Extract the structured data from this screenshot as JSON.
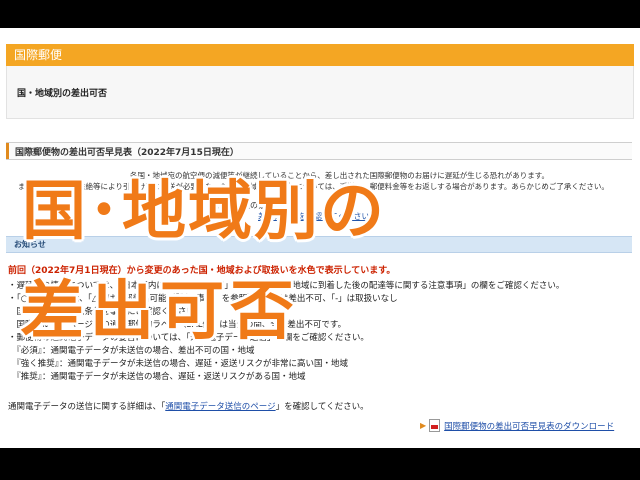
{
  "colors": {
    "header_orange": "#f4a623",
    "overlay_orange": "#f07a18",
    "notice_red": "#cc2200",
    "link_blue": "#1f4fa8",
    "info_bar_blue": "#d6e6f5"
  },
  "header": {
    "title": "国際郵便"
  },
  "breadcrumb": {
    "current": "国・地域別の差出可否"
  },
  "section": {
    "title": "国際郵便物の差出可否早見表（2022年7月15日現在）"
  },
  "notices": {
    "line1": "各国・地域宛の航空便の減便等が継続していることから、差し出された国際郵便物のお届けに遅延が生じる恐れがあります。",
    "line2": "また、輸送経路の途絶等により引受け後に返送が必要となった国・地域宛の郵便物については、返送し、郵便料金等をお返しする場合があります。あらかじめご了承ください。",
    "line3": "差出・配達の条件は",
    "link": "差出条件表を確認してください"
  },
  "info_bar": {
    "label": "お知らせ"
  },
  "change_notice": "前回（2022年7月1日現在）から変更のあった国・地域および取扱いを水色で表示しています。",
  "bullets": [
    "・遅延等の情報については、「日本国内における遅延情報」および「各国・地域に到着した後の配達等に関する注意事項」の欄をご確認ください。",
    "・「○」は差出可能、「△」は一部差出可能（「制限事項」を参照）、「×」は差出不可、「-」は取扱いなし",
    "　国際郵便物の差出条件を事前にご確認ください。",
    "　国際郵便マイページ等の通関郵便物ラベル（SAL便）は当分の間、全て差出不可です。",
    "・郵便物の通関電子データの要否については、「通関電子データ送信」の欄をご確認ください。",
    "　『必須』：通関電子データが未送信の場合、差出不可の国・地域",
    "　『強く推奨』：通関電子データが未送信の場合、遅延・返送リスクが非常に高い国・地域",
    "　『推奨』：通関電子データが未送信の場合、遅延・返送リスクがある国・地域"
  ],
  "footer": {
    "text_before": "通関電子データの送信に関する詳細は、「",
    "link": "通関電子データ送信のページ",
    "text_after": "」を確認してください。"
  },
  "download": {
    "arrow": "▶",
    "link": "国際郵便物の差出可否早見表のダウンロード"
  },
  "overlay": {
    "line1": "国･地域別の",
    "line2": "差出可否"
  }
}
